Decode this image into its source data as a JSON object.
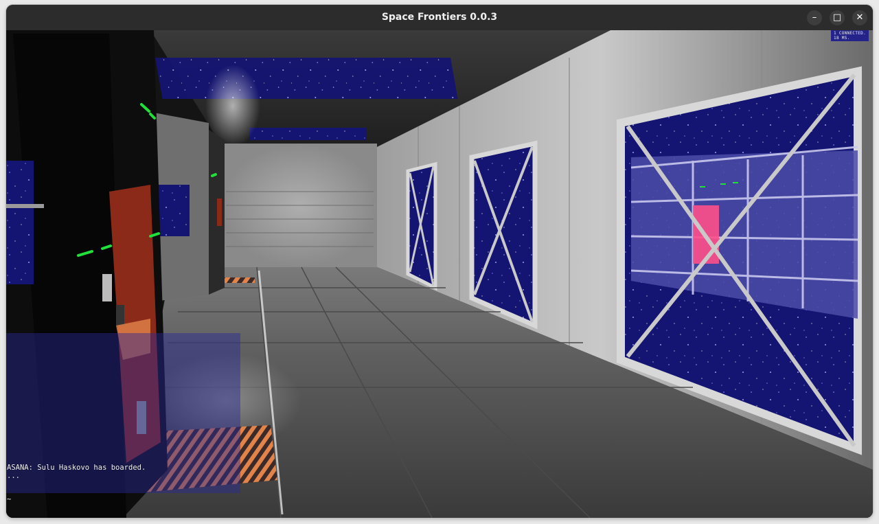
{
  "window": {
    "title": "Space Frontiers 0.0.3",
    "minimize_glyph": "–",
    "maximize_glyph": "□",
    "close_glyph": "✕"
  },
  "hud": {
    "network_status": "1 CONNECTED.",
    "ping": "18 MS."
  },
  "chat": {
    "messages": [
      "ASANA: Sulu Haskovo has boarded.",
      "..."
    ],
    "input_prompt": "~"
  },
  "colors": {
    "space_blue": "#1a1a8c",
    "status_light_green": "#22e03a",
    "chat_panel_blue": "#2828a0",
    "hazard_orange": "#e2844a",
    "panel_red": "#8c2a1a"
  }
}
